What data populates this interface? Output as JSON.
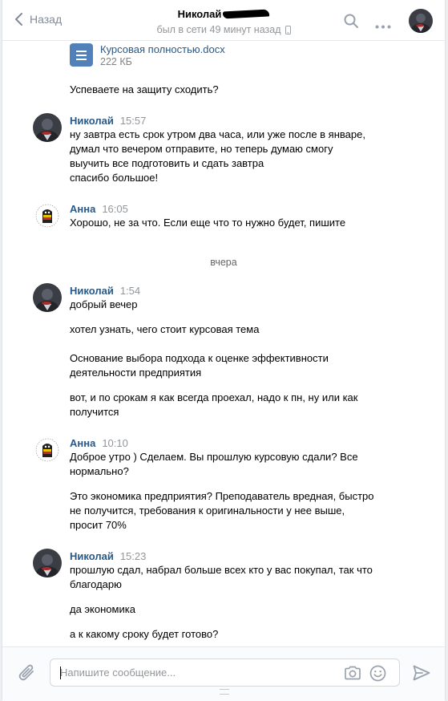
{
  "header": {
    "back_label": "Назад",
    "peer_name": "Николай",
    "peer_status": "был в сети 49 минут назад"
  },
  "attachment": {
    "name": "Курсовая полностью.docx",
    "size": "222 КБ"
  },
  "composer": {
    "placeholder": "Напишите сообщение..."
  },
  "messages": [
    {
      "lines": [
        "Успеваете на защиту сходить?"
      ]
    },
    {
      "author": "Николай",
      "time": "15:57",
      "lines": [
        "ну завтра есть срок утром два часа, или уже после в январе,",
        "думал что вечером отправите, но теперь думаю смогу",
        "выучить все подготовить и сдать завтра",
        "спасибо большое!"
      ]
    },
    {
      "author": "Анна",
      "time": "16:05",
      "lines": [
        "Хорошо, не за что. Если еще что то нужно будет, пишите"
      ]
    },
    {
      "divider": "вчера"
    },
    {
      "author": "Николай",
      "time": "1:54",
      "lines": [
        "добрый вечер",
        "хотел узнать, чего стоит курсовая тема",
        "Основание выбора подхода к оценке эффективности",
        "деятельности предприятия",
        "вот, и по срокам я как всегда проехал, надо к пн, ну или как",
        "получится"
      ]
    },
    {
      "author": "Анна",
      "time": "10:10",
      "lines": [
        "Доброе утро ) Сделаем. Вы прошлую курсовую сдали? Все",
        "нормально?",
        "Это экономика предприятия? Преподаватель вредная, быстро",
        "не получится, требования к оригинальности у нее выше,",
        "просит 70%"
      ]
    },
    {
      "author": "Николай",
      "time": "15:23",
      "lines": [
        "прошлую сдал, набрал больше всех кто у вас покупал, так что",
        "благодарю",
        "да экономика",
        "а к какому сроку будет готово?"
      ]
    }
  ],
  "colors": {
    "link": "#2a5885",
    "muted": "#939699",
    "accent": "#5181b8"
  }
}
